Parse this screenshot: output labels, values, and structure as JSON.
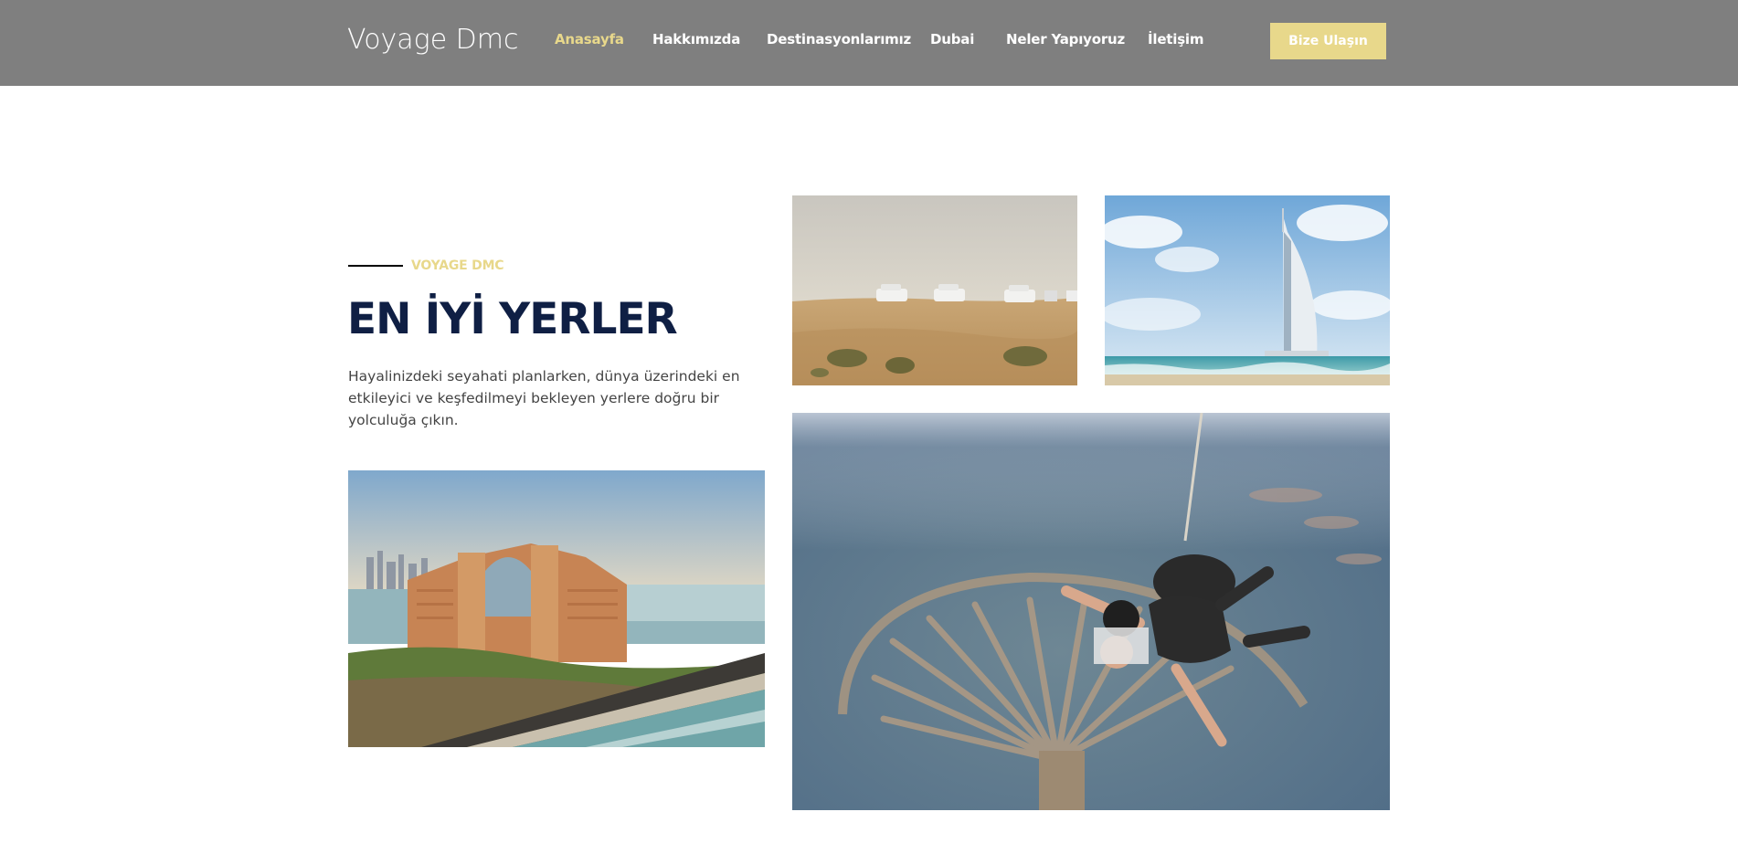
{
  "header": {
    "logo": "Voyage Dmc",
    "nav": [
      {
        "label": "Anasayfa",
        "active": true
      },
      {
        "label": "Hakkımızda",
        "active": false
      },
      {
        "label": "Destinasyonlarımız",
        "active": false
      },
      {
        "label": "Dubai",
        "active": false
      },
      {
        "label": "Neler Yapıyoruz",
        "active": false
      },
      {
        "label": "İletişim",
        "active": false
      }
    ],
    "cta_label": "Bize Ulaşın"
  },
  "intro": {
    "eyebrow": "VOYAGE DMC",
    "headline": "EN İYİ YERLER",
    "description": "Hayalinizdeki seyahati planlarken, dünya üzerindeki en etkileyici ve keşfedilmeyi bekleyen yerlere doğru bir yolculuğa çıkın."
  },
  "colors": {
    "header_bg": "#7f7f7f",
    "accent": "#e8d88b",
    "headline": "#0f1f44",
    "body_text": "#444444"
  }
}
